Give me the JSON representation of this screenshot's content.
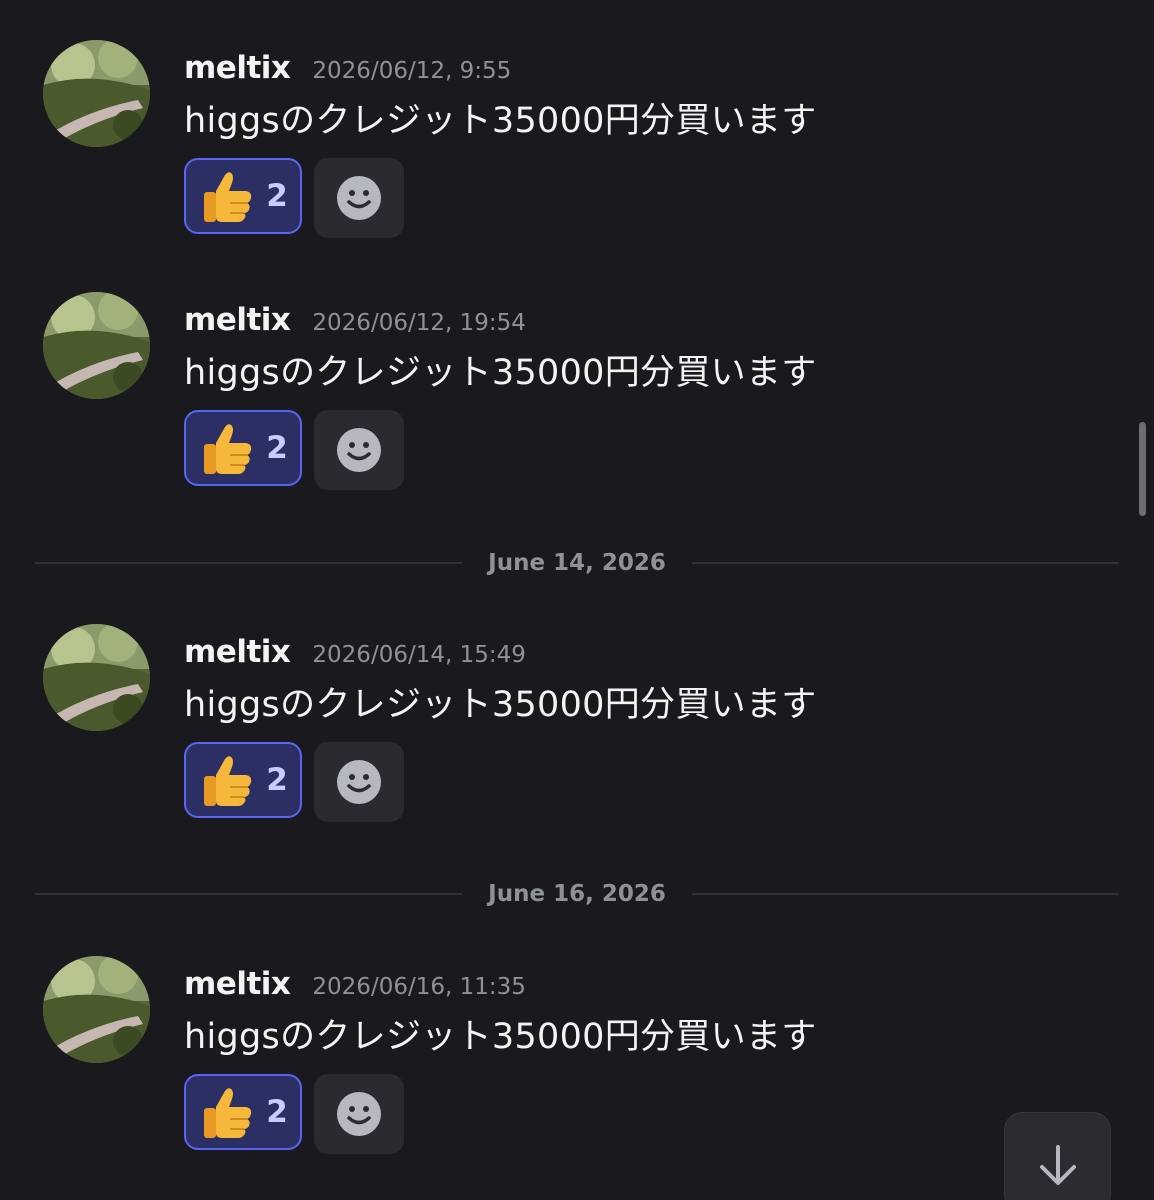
{
  "messages": [
    {
      "author": "meltix",
      "timestamp": "2026/06/12, 9:55",
      "content": "higgsのクレジット35000円分買います",
      "reaction": {
        "emoji": "thumbs-up",
        "count": "2"
      }
    },
    {
      "author": "meltix",
      "timestamp": "2026/06/12, 19:54",
      "content": "higgsのクレジット35000円分買います",
      "reaction": {
        "emoji": "thumbs-up",
        "count": "2"
      }
    },
    {
      "author": "meltix",
      "timestamp": "2026/06/14, 15:49",
      "content": "higgsのクレジット35000円分買います",
      "reaction": {
        "emoji": "thumbs-up",
        "count": "2"
      }
    },
    {
      "author": "meltix",
      "timestamp": "2026/06/16, 11:35",
      "content": "higgsのクレジット35000円分買います",
      "reaction": {
        "emoji": "thumbs-up",
        "count": "2"
      }
    }
  ],
  "dividers": [
    {
      "label": "June 14, 2026"
    },
    {
      "label": "June 16, 2026"
    }
  ],
  "icons": {
    "add_reaction": "smiley-add-icon",
    "jump_to_present": "arrow-down-icon"
  },
  "colors": {
    "background": "#1a1a1e",
    "reaction_border": "#5865f2",
    "reaction_bg": "#2c2f63",
    "timestamp": "#8e9297"
  }
}
